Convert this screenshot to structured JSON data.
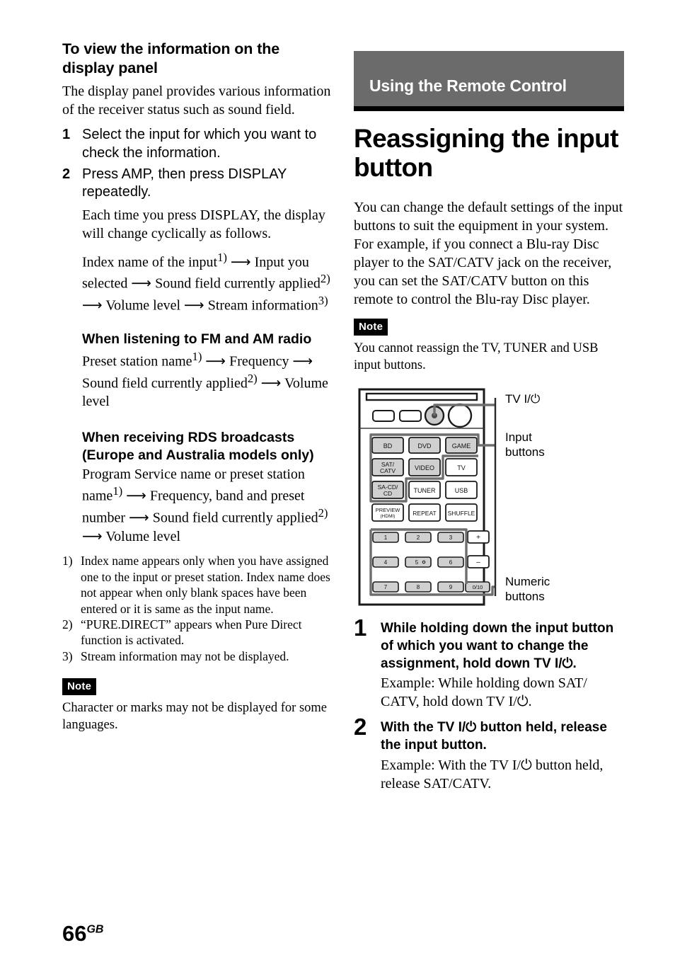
{
  "page": {
    "number": "66",
    "region_code": "GB"
  },
  "left_column": {
    "heading": "To view the information on the display panel",
    "intro": "The display panel provides various information of the receiver status such as sound field.",
    "steps": [
      {
        "number": "1",
        "title": "Select the input for which you want to check the information.",
        "body": []
      },
      {
        "number": "2",
        "title": "Press AMP, then press DISPLAY repeatedly.",
        "body": [
          "Each time you press DISPLAY, the display will change cyclically as follows."
        ]
      }
    ],
    "cycle_sequence": {
      "prefix": "Index name of the input",
      "mark1": "1)",
      "item2": "Input you selected",
      "item3": "Sound field currently applied",
      "mark2": "2)",
      "item4": "Volume level",
      "item5": "Stream information",
      "mark3": "3)"
    },
    "fm_am": {
      "heading": "When listening to FM and AM radio",
      "seq_1": "Preset station name",
      "mark1": "1)",
      "seq_2": "Frequency",
      "seq_3": "Sound field currently applied",
      "mark2": "2)",
      "seq_4": "Volume level"
    },
    "rds": {
      "heading_line1": "When receiving RDS broadcasts",
      "heading_line2": "(Europe and Australia models only)",
      "seq_1": "Program Service name or preset station name",
      "mark1": "1)",
      "seq_2": "Frequency, band and preset number",
      "seq_3": "Sound field currently applied",
      "mark2": "2)",
      "seq_4": "Volume level"
    },
    "footnotes": [
      {
        "mark": "1)",
        "text": "Index name appears only when you have assigned one to the input or preset station. Index name does not appear when only blank spaces have been entered or it is same as the input name."
      },
      {
        "mark": "2)",
        "text": "“PURE.DIRECT” appears when Pure Direct function is activated."
      },
      {
        "mark": "3)",
        "text": "Stream information may not be displayed."
      }
    ],
    "note": {
      "label": "Note",
      "text": "Character or marks may not be displayed for some languages."
    }
  },
  "right_column": {
    "banner": "Using the Remote Control",
    "title": "Reassigning the input button",
    "intro": "You can change the default settings of the input buttons to suit the equipment in your system. For example, if you connect a Blu-ray Disc player to the SAT/CATV jack on the receiver, you can set the SAT/CATV button on this remote to control the Blu-ray Disc player.",
    "note": {
      "label": "Note",
      "text": "You cannot reassign the TV, TUNER and USB input buttons."
    },
    "figure": {
      "callouts": [
        {
          "id": "tv-power",
          "label": "TV I/⏻"
        },
        {
          "id": "input-buttons",
          "label_line1": "Input",
          "label_line2": "buttons"
        },
        {
          "id": "numeric-buttons",
          "label_line1": "Numeric",
          "label_line2": "buttons"
        }
      ],
      "input_buttons": [
        {
          "label": "BD",
          "highlighted": true
        },
        {
          "label": "DVD",
          "highlighted": true
        },
        {
          "label": "GAME",
          "highlighted": true
        },
        {
          "label": "SAT/ CATV",
          "highlighted": true
        },
        {
          "label": "VIDEO",
          "highlighted": true
        },
        {
          "label": "TV",
          "highlighted": false
        },
        {
          "label": "SA-CD/ CD",
          "highlighted": true
        },
        {
          "label": "TUNER",
          "highlighted": false
        },
        {
          "label": "USB",
          "highlighted": false
        }
      ],
      "function_buttons": [
        {
          "label": "PREVIEW (HDMI)"
        },
        {
          "label": "REPEAT"
        },
        {
          "label": "SHUFFLE"
        }
      ],
      "numeric_buttons": [
        "1",
        "2",
        "3",
        "4",
        "5",
        "6",
        "7",
        "8",
        "9",
        "0/10"
      ],
      "volume_buttons": [
        "+",
        "–"
      ]
    },
    "steps": [
      {
        "number": "1",
        "title": "While holding down the input button of which you want to change the assignment, hold down TV I/⏻.",
        "example": "Example: While holding down SAT/ CATV, hold down TV I/⏻."
      },
      {
        "number": "2",
        "title": "With the TV I/⏻ button held, release the input button.",
        "example": "Example: With the TV I/⏻ button held, release SAT/CATV."
      }
    ]
  },
  "colors": {
    "banner_gray": "#6b6b6b",
    "rule_black": "#000000",
    "button_fill": "#d0d0d0",
    "callout_line": "#6e6e6e"
  }
}
